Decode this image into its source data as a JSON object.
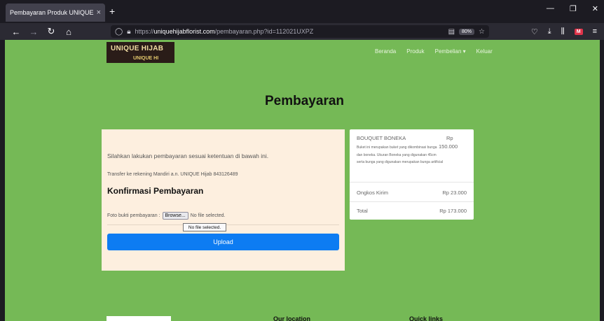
{
  "browser": {
    "tab_title": "Pembayaran Produk UNIQUE Hijab",
    "tab_close_icon": "×",
    "new_tab_icon": "+",
    "url_scheme": "https://",
    "url_host": "uniquehijabflorist.com",
    "url_path": "/pembayaran.php?id=112021UXPZ",
    "zoom": "80%"
  },
  "site": {
    "logo_main": "UNIQUE HIJAB",
    "logo_sub": "UNIQUE HI",
    "nav": {
      "home": "Beranda",
      "products": "Produk",
      "purchase": "Pembelian",
      "purchase_caret": "▾",
      "logout": "Keluar"
    },
    "page_title": "Pembayaran"
  },
  "payment": {
    "instructions": "Silahkan lakukan pembayaran sesuai ketentuan di bawah ini.",
    "transfer": "Transfer ke rekening Mandiri a.n. UNIQUE Hijab 843126489",
    "confirm_heading": "Konfirmasi Pembayaran",
    "file_label": "Foto bukti pembayaran :",
    "browse_label": "Browse...",
    "no_file": "No file selected.",
    "tooltip": "No file selected.",
    "upload_label": "Upload"
  },
  "summary": {
    "product_name": "BOUQUET BONEKA",
    "price_currency": "Rp",
    "price_value": "150.000",
    "description": "Buket ini merupakan buket yang dikombinasi bunga dan boneka. Ukuran Boneka yang digunakan 45cm serta bunga yang digunakan merupakan bunga artificial",
    "shipping_label": "Ongkos Kirim",
    "shipping_value": "Rp 23.000",
    "total_label": "Total",
    "total_value": "Rp 173.000"
  },
  "footer": {
    "location_heading": "Our location",
    "links_heading": "Quick links"
  },
  "colors": {
    "page_bg": "#75b956",
    "card_bg": "#fdefdf",
    "upload_button": "#0d7cf2"
  }
}
